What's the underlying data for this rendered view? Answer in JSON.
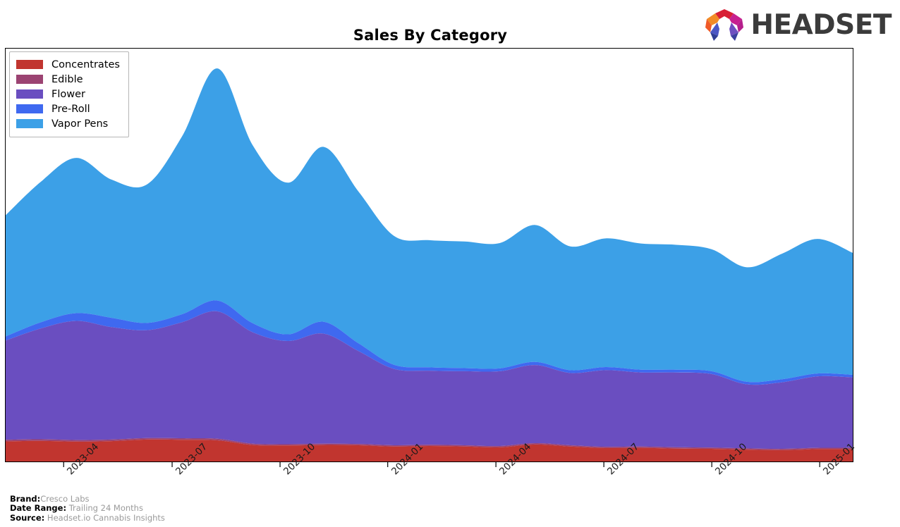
{
  "header": {
    "title": "Sales By Category",
    "logo_text": "HEADSET",
    "logo_icon": "headset-hexagon-logo"
  },
  "footer": {
    "brand_label": "Brand:",
    "brand_value": "Cresco Labs",
    "date_range_label": "Date Range:",
    "date_range_value": "Trailing 24 Months",
    "source_label": "Source:",
    "source_value": "Headset.io Cannabis Insights"
  },
  "chart_data": {
    "type": "area",
    "stacked": true,
    "title": "Sales By Category",
    "xlabel": "",
    "ylabel": "",
    "grid": false,
    "legend_position": "upper-left",
    "axis": {
      "x_tick_labels": [
        "2023-04",
        "2023-07",
        "2023-10",
        "2024-01",
        "2024-04",
        "2024-07",
        "2024-10",
        "2025-01"
      ],
      "x_tick_positions": [
        0.0865,
        0.2463,
        0.4053,
        0.5639,
        0.7233,
        0.8823,
        1.0413,
        1.2003
      ],
      "y_axis_visible": false,
      "ylim": [
        0,
        1
      ]
    },
    "x": [
      "2023-01",
      "2023-02",
      "2023-03",
      "2023-04",
      "2023-05",
      "2023-06",
      "2023-07",
      "2023-08",
      "2023-09",
      "2023-10",
      "2023-11",
      "2023-12",
      "2024-01",
      "2024-02",
      "2024-03",
      "2024-04",
      "2024-05",
      "2024-06",
      "2024-07",
      "2024-08",
      "2024-09",
      "2024-10",
      "2024-11",
      "2024-12",
      "2025-01"
    ],
    "series": [
      {
        "name": "Concentrates",
        "color": "#c1352f",
        "values": [
          0.078,
          0.08,
          0.077,
          0.079,
          0.085,
          0.084,
          0.082,
          0.064,
          0.062,
          0.064,
          0.063,
          0.058,
          0.06,
          0.058,
          0.055,
          0.066,
          0.058,
          0.052,
          0.053,
          0.05,
          0.049,
          0.046,
          0.044,
          0.048,
          0.048
        ]
      },
      {
        "name": "Edible",
        "color": "#9b4372",
        "values": [
          0.006,
          0.006,
          0.006,
          0.006,
          0.006,
          0.006,
          0.006,
          0.005,
          0.005,
          0.005,
          0.005,
          0.005,
          0.005,
          0.005,
          0.005,
          0.005,
          0.005,
          0.005,
          0.005,
          0.005,
          0.005,
          0.005,
          0.005,
          0.005,
          0.005
        ]
      },
      {
        "name": "Flower",
        "color": "#6a4ec0",
        "values": [
          0.385,
          0.43,
          0.462,
          0.436,
          0.418,
          0.45,
          0.494,
          0.432,
          0.4,
          0.427,
          0.36,
          0.296,
          0.287,
          0.287,
          0.29,
          0.303,
          0.28,
          0.297,
          0.287,
          0.29,
          0.285,
          0.248,
          0.258,
          0.277,
          0.273
        ]
      },
      {
        "name": "Pre-Roll",
        "color": "#3f69f0",
        "values": [
          0.016,
          0.024,
          0.03,
          0.036,
          0.028,
          0.031,
          0.042,
          0.035,
          0.026,
          0.046,
          0.03,
          0.016,
          0.013,
          0.012,
          0.011,
          0.012,
          0.011,
          0.012,
          0.011,
          0.011,
          0.011,
          0.01,
          0.012,
          0.011,
          0.01
        ]
      },
      {
        "name": "Vapor Pens",
        "color": "#3ca0e7",
        "values": [
          0.47,
          0.545,
          0.602,
          0.536,
          0.537,
          0.69,
          0.9,
          0.69,
          0.588,
          0.678,
          0.588,
          0.5,
          0.493,
          0.491,
          0.486,
          0.531,
          0.48,
          0.499,
          0.489,
          0.484,
          0.473,
          0.444,
          0.487,
          0.522,
          0.473
        ]
      }
    ]
  },
  "legend": {
    "items": [
      {
        "label": "Concentrates",
        "color": "#c1352f"
      },
      {
        "label": "Edible",
        "color": "#9b4372"
      },
      {
        "label": "Flower",
        "color": "#6a4ec0"
      },
      {
        "label": "Pre-Roll",
        "color": "#3f69f0"
      },
      {
        "label": "Vapor Pens",
        "color": "#3ca0e7"
      }
    ]
  }
}
